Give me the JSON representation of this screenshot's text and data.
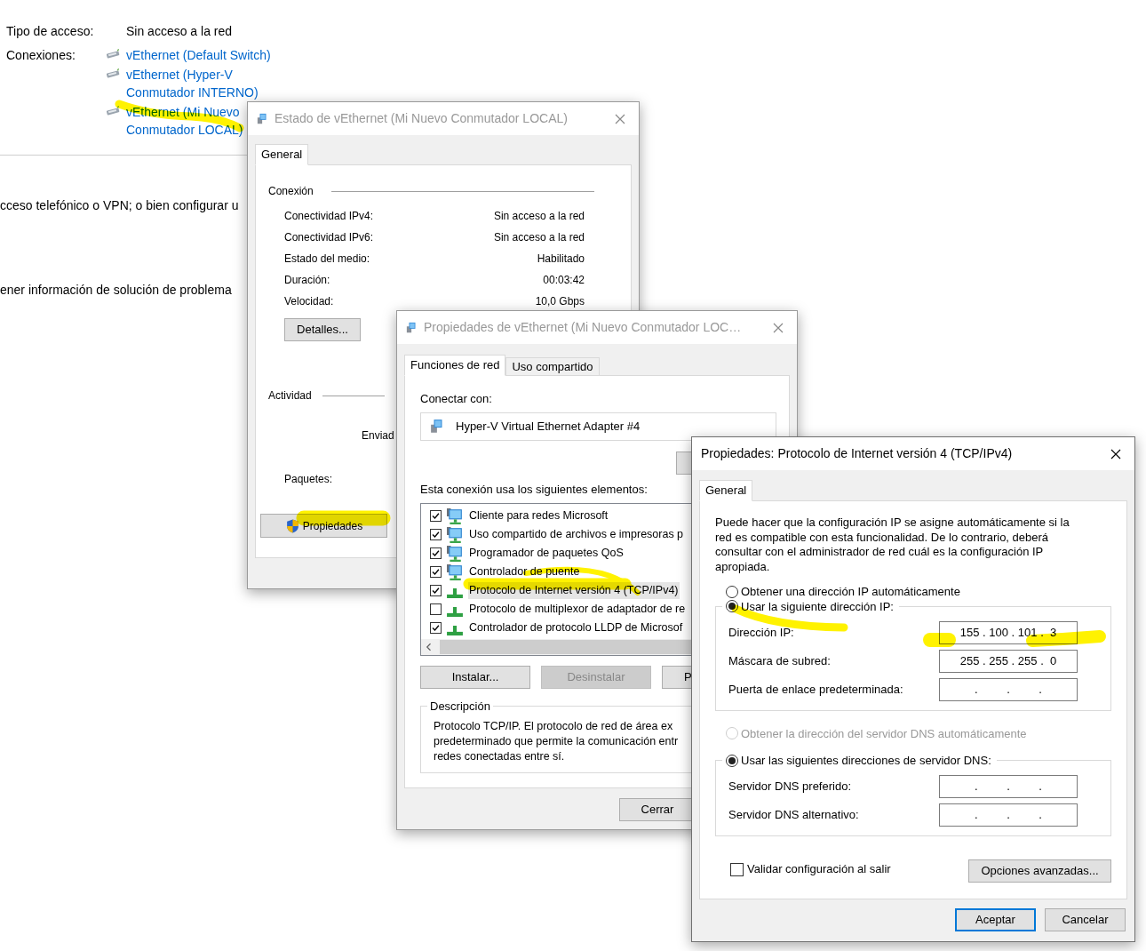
{
  "background_page": {
    "fields": [
      {
        "label": "Tipo de acceso:",
        "value": "Sin acceso a la red"
      }
    ],
    "connections": {
      "label": "Conexiones:",
      "links": [
        "vEthernet (Default Switch)",
        "vEthernet (Hyper-V Conmutador INTERNO)",
        "vEthernet (Mi Nuevo Conmutador LOCAL)"
      ]
    },
    "text_fragments": [
      "cceso telefónico o VPN; o bien configurar u",
      "ener información de solución de problema"
    ]
  },
  "status_window": {
    "title": "Estado de vEthernet (Mi Nuevo Conmutador LOCAL)",
    "active": false,
    "tabs": [
      {
        "label": "General",
        "selected": true
      }
    ],
    "connection_section": {
      "heading": "Conexión",
      "rows": [
        {
          "label": "Conectividad IPv4:",
          "value": "Sin acceso a la red"
        },
        {
          "label": "Conectividad IPv6:",
          "value": "Sin acceso a la red"
        },
        {
          "label": "Estado del medio:",
          "value": "Habilitado"
        },
        {
          "label": "Duración:",
          "value": "00:03:42"
        },
        {
          "label": "Velocidad:",
          "value": "10,0 Gbps"
        }
      ]
    },
    "details_button": "Detalles...",
    "activity_section": {
      "heading": "Actividad",
      "sent_label": "Enviad",
      "packets_label": "Paquetes:"
    },
    "properties_button": "Propiedades"
  },
  "properties_window": {
    "title": "Propiedades de vEthernet (Mi Nuevo Conmutador LOC…",
    "active": false,
    "tabs": [
      {
        "label": "Funciones de red",
        "selected": true
      },
      {
        "label": "Uso compartido",
        "selected": false
      }
    ],
    "connect_label": "Conectar con:",
    "adapter": "Hyper-V Virtual Ethernet Adapter #4",
    "items_label": "Esta conexión usa los siguientes elementos:",
    "items": [
      {
        "label": "Cliente para redes Microsoft",
        "checked": true,
        "selected": false,
        "kind": "monitor"
      },
      {
        "label": "Uso compartido de archivos e impresoras p",
        "checked": true,
        "selected": false,
        "kind": "monitor"
      },
      {
        "label": "Programador de paquetes QoS",
        "checked": true,
        "selected": false,
        "kind": "monitor"
      },
      {
        "label": "Controlador de puente",
        "checked": true,
        "selected": false,
        "kind": "monitor"
      },
      {
        "label": "Protocolo de Internet versión 4 (TCP/IPv4)",
        "checked": true,
        "selected": true,
        "kind": "protocol"
      },
      {
        "label": "Protocolo de multiplexor de adaptador de re",
        "checked": false,
        "selected": false,
        "kind": "protocol"
      },
      {
        "label": "Controlador de protocolo LLDP de Microsof",
        "checked": true,
        "selected": false,
        "kind": "protocol"
      }
    ],
    "buttons": [
      {
        "label": "Instalar...",
        "disabled": false
      },
      {
        "label": "Desinstalar",
        "disabled": true
      },
      {
        "label": "P",
        "disabled": false
      }
    ],
    "description": {
      "heading": "Descripción",
      "lines": [
        "Protocolo TCP/IP. El protocolo de red de área ex",
        "predeterminado que permite la comunicación entr",
        "redes conectadas entre sí."
      ]
    },
    "close_button": "Cerrar"
  },
  "ipv4_window": {
    "title": "Propiedades: Protocolo de Internet versión 4 (TCP/IPv4)",
    "active": true,
    "tabs": [
      {
        "label": "General",
        "selected": true
      }
    ],
    "intro": "Puede hacer que la configuración IP se asigne automáticamente si la red es compatible con esta funcionalidad. De lo contrario, deberá consultar con el administrador de red cuál es la configuración IP apropiada.",
    "ip_options": [
      {
        "label": "Obtener una dirección IP automáticamente",
        "selected": false,
        "disabled": false
      },
      {
        "label": "Usar la siguiente dirección IP:",
        "selected": true,
        "disabled": false
      }
    ],
    "ip_fields": [
      {
        "label": "Dirección IP:",
        "value": "155 . 100 . 101 .  3"
      },
      {
        "label": "Máscara de subred:",
        "value": "255 . 255 . 255 .  0"
      },
      {
        "label": "Puerta de enlace predeterminada:",
        "value": ".         .         ."
      }
    ],
    "dns_options": [
      {
        "label": "Obtener la dirección del servidor DNS automáticamente",
        "selected": false,
        "disabled": true
      },
      {
        "label": "Usar las siguientes direcciones de servidor DNS:",
        "selected": true,
        "disabled": false
      }
    ],
    "dns_fields": [
      {
        "label": "Servidor DNS preferido:",
        "value": ".         .         ."
      },
      {
        "label": "Servidor DNS alternativo:",
        "value": ".         .         ."
      }
    ],
    "validate": {
      "label": "Validar configuración al salir",
      "checked": false
    },
    "advanced_button": "Opciones avanzadas...",
    "buttons": [
      {
        "label": "Aceptar",
        "default": true
      },
      {
        "label": "Cancelar",
        "default": false
      }
    ]
  },
  "highlighter": {
    "color": "#fff200"
  }
}
